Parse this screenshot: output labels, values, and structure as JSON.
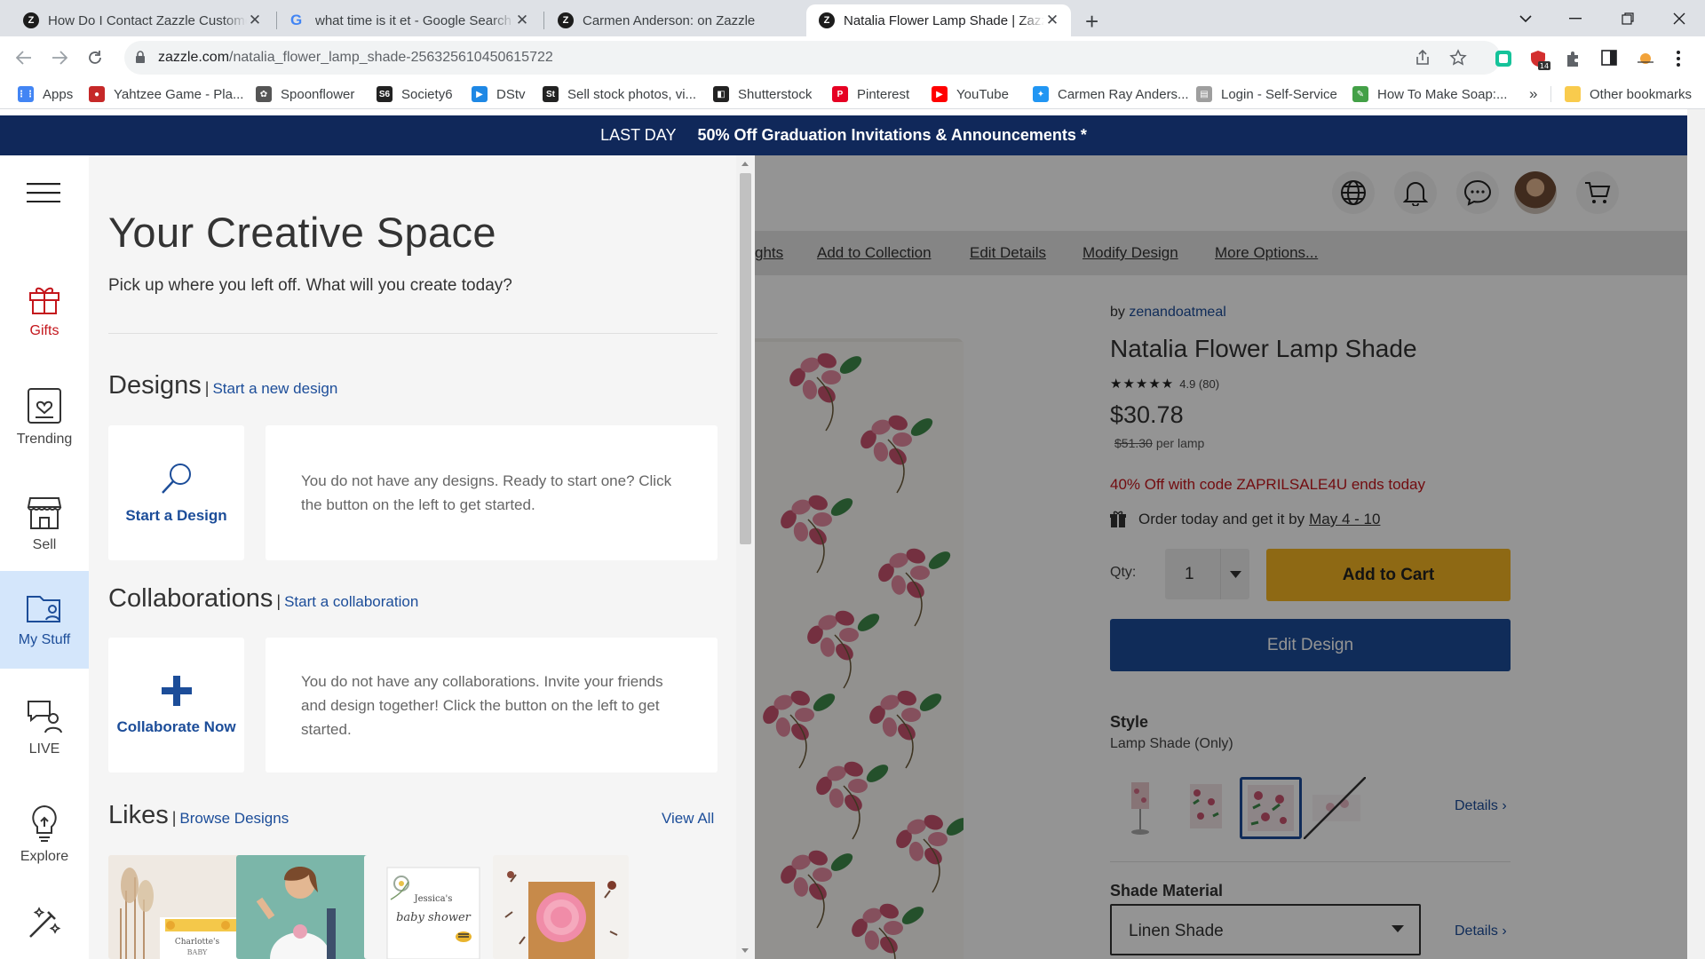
{
  "browser": {
    "tabs": [
      {
        "title": "How Do I Contact Zazzle Customer Service",
        "favicon": "zazzle-icon"
      },
      {
        "title": "what time is it et - Google Search",
        "favicon": "google-icon"
      },
      {
        "title": "Carmen Anderson: on Zazzle",
        "favicon": "zazzle-icon"
      },
      {
        "title": "Natalia Flower Lamp Shade | Zazzle",
        "favicon": "zazzle-icon"
      }
    ],
    "url_host": "zazzle.com",
    "url_path": "/natalia_flower_lamp_shade-256325610450615722",
    "extension_badge": "14",
    "bookmarks": [
      {
        "label": "Apps",
        "icon": "apps-grid-icon",
        "color": "#4285f4"
      },
      {
        "label": "Yahtzee Game - Pla...",
        "icon": "dice-icon",
        "color": "#c62828"
      },
      {
        "label": "Spoonflower",
        "icon": "spoonflower-icon",
        "color": "#555555"
      },
      {
        "label": "Society6",
        "icon": "society6-icon",
        "color": "#222222"
      },
      {
        "label": "DStv",
        "icon": "dstv-icon",
        "color": "#1e88e5"
      },
      {
        "label": "Sell stock photos, vi...",
        "icon": "st-icon",
        "color": "#222222"
      },
      {
        "label": "Shutterstock",
        "icon": "shutterstock-icon",
        "color": "#222222"
      },
      {
        "label": "Pinterest",
        "icon": "pinterest-icon",
        "color": "#e60023"
      },
      {
        "label": "YouTube",
        "icon": "youtube-icon",
        "color": "#ff0000"
      },
      {
        "label": "Carmen Ray Anders...",
        "icon": "person-icon",
        "color": "#2196f3"
      },
      {
        "label": "Login - Self-Service",
        "icon": "doc-icon",
        "color": "#9e9e9e"
      },
      {
        "label": "How To Make Soap:...",
        "icon": "diy-icon",
        "color": "#43a047"
      }
    ],
    "bookmarks_overflow": "»",
    "other_bookmarks": "Other bookmarks"
  },
  "promo": {
    "prefix": "LAST DAY",
    "text": "50% Off Graduation Invitations & Announcements *"
  },
  "rail": {
    "items": [
      {
        "label": "Gifts",
        "icon": "gift-icon"
      },
      {
        "label": "Trending",
        "icon": "trending-heart-icon"
      },
      {
        "label": "Sell",
        "icon": "storefront-icon"
      },
      {
        "label": "My Stuff",
        "icon": "folder-person-icon"
      },
      {
        "label": "LIVE",
        "icon": "live-chat-icon"
      },
      {
        "label": "Explore",
        "icon": "lightbulb-icon"
      },
      {
        "label": "",
        "icon": "magic-wand-icon"
      }
    ]
  },
  "panel": {
    "title": "Your Creative Space",
    "subtitle": "Pick up where you left off. What will you create today?",
    "designs": {
      "heading": "Designs",
      "link": "Start a new design",
      "button": "Start a Design",
      "message": "You do not have any designs. Ready to start one? Click the button on the left to get started."
    },
    "collaborations": {
      "heading": "Collaborations",
      "link": "Start a collaboration",
      "button": "Collaborate Now",
      "message": "You do not have any collaborations. Invite your friends and design together! Click the button on the left to get started."
    },
    "likes": {
      "heading": "Likes",
      "link": "Browse Designs",
      "view_all": "View All",
      "thumb_labels": [
        "Charlotte's",
        "BABY",
        "Jessica's",
        "baby shower"
      ]
    }
  },
  "product": {
    "subnav": [
      "ghts",
      "Add to Collection",
      "Edit Details",
      "Modify Design",
      "More Options..."
    ],
    "by_prefix": "by",
    "designer": "zenandoatmeal",
    "title": "Natalia Flower Lamp Shade",
    "stars": "★★★★★",
    "rating": "4.9 (80)",
    "price": "$30.78",
    "old_price": "$51.30",
    "price_unit": "per lamp",
    "discount": "40% Off with code ZAPRILSALE4U ends today",
    "delivery_text": "Order today and get it by",
    "delivery_dates": "May 4 - 10",
    "qty_label": "Qty:",
    "qty_value": "1",
    "add_to_cart": "Add to Cart",
    "edit_design": "Edit Design",
    "style_heading": "Style",
    "style_value": "Lamp Shade (Only)",
    "details_label": "Details",
    "material_heading": "Shade Material",
    "material_value": "Linen Shade",
    "colors": {
      "accent_blue": "#1c4d99",
      "cart_yellow": "#f4b623",
      "sale_red": "#c4161c",
      "promo_navy": "#10285a"
    }
  }
}
